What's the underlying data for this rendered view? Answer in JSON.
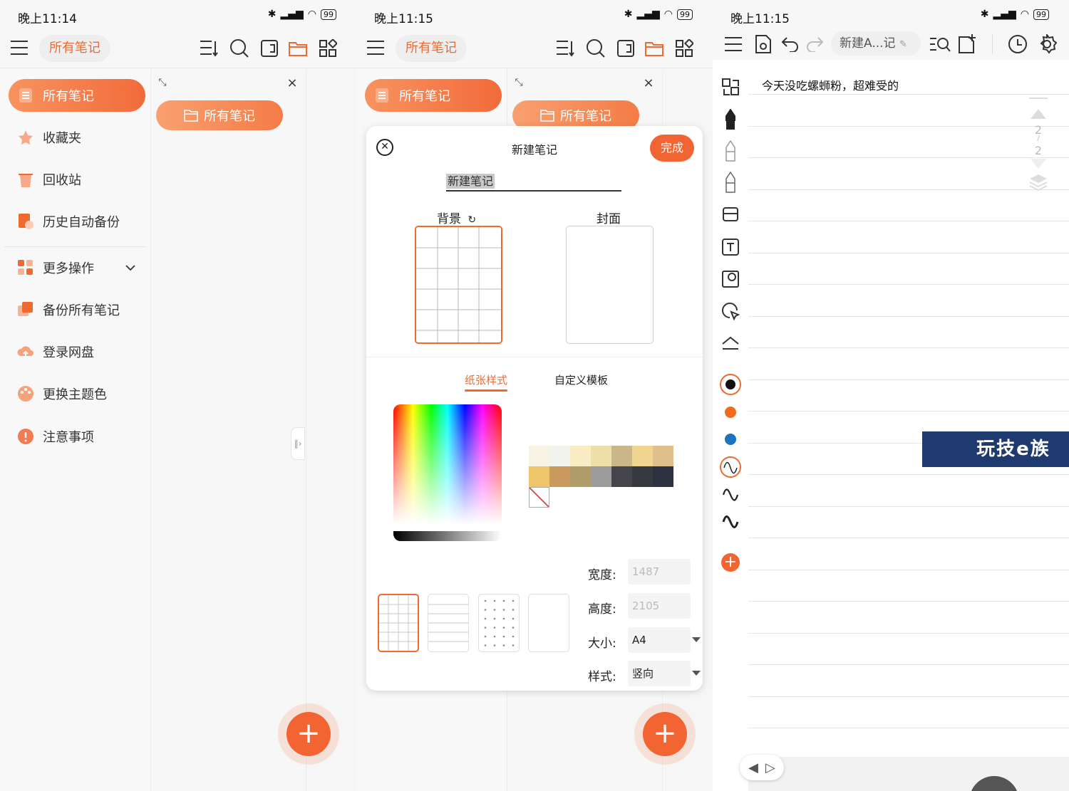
{
  "panel1": {
    "status": {
      "time": "晚上11:14",
      "battery": "99"
    },
    "header": {
      "title": "所有笔记"
    },
    "sidebar": {
      "items": [
        {
          "label": "所有笔记",
          "icon": "notes-icon",
          "color": "#ffffff"
        },
        {
          "label": "收藏夹",
          "icon": "star-icon",
          "color": "#f06a30"
        },
        {
          "label": "回收站",
          "icon": "trash-icon",
          "color": "#f06a30"
        },
        {
          "label": "历史自动备份",
          "icon": "history-backup-icon",
          "color": "#f06a30"
        },
        {
          "label": "更多操作",
          "icon": "grid-icon",
          "color": "#f06a30"
        },
        {
          "label": "备份所有笔记",
          "icon": "backup-icon",
          "color": "#f06a30"
        },
        {
          "label": "登录网盘",
          "icon": "cloud-upload-icon",
          "color": "#f06a30"
        },
        {
          "label": "更换主题色",
          "icon": "palette-icon",
          "color": "#f06a30"
        },
        {
          "label": "注意事项",
          "icon": "warning-icon",
          "color": "#f06a30"
        }
      ]
    },
    "list": {
      "folder_button": "所有笔记"
    }
  },
  "panel2": {
    "status": {
      "time": "晚上11:15",
      "battery": "99"
    },
    "header": {
      "title": "所有笔记"
    },
    "sidebar_active": "所有笔记",
    "folder_button": "所有笔记",
    "dialog": {
      "title": "新建笔记",
      "done": "完成",
      "name_value": "新建笔记",
      "background_label": "背景",
      "cover_label": "封面",
      "tabs": [
        "纸张样式",
        "自定义模板"
      ],
      "width_label": "宽度:",
      "width_value": "1487",
      "height_label": "高度:",
      "height_value": "2105",
      "size_label": "大小:",
      "size_value": "A4",
      "style_label": "样式:",
      "style_value": "竖向",
      "swatch_colors": [
        "#f7f4e6",
        "#f3f3ee",
        "#f7ecc4",
        "#eedfa8",
        "#cbb68a",
        "#efd58f",
        "#e0c08a",
        "#eec56b",
        "#c9995d",
        "#b09b6a",
        "#9b9b9b",
        "#44444a",
        "#36393d",
        "#2d3240"
      ]
    }
  },
  "panel3": {
    "status": {
      "time": "晚上11:15",
      "battery": "99"
    },
    "note_title": "新建A...记",
    "note_text": "今天没吃螺蛳粉，超难受的",
    "page_current": "2",
    "page_total": "2",
    "banner": "玩技e族",
    "pen_colors": [
      "#111111",
      "#f26a1b",
      "#1e73be"
    ],
    "accent": "#f06a30"
  }
}
